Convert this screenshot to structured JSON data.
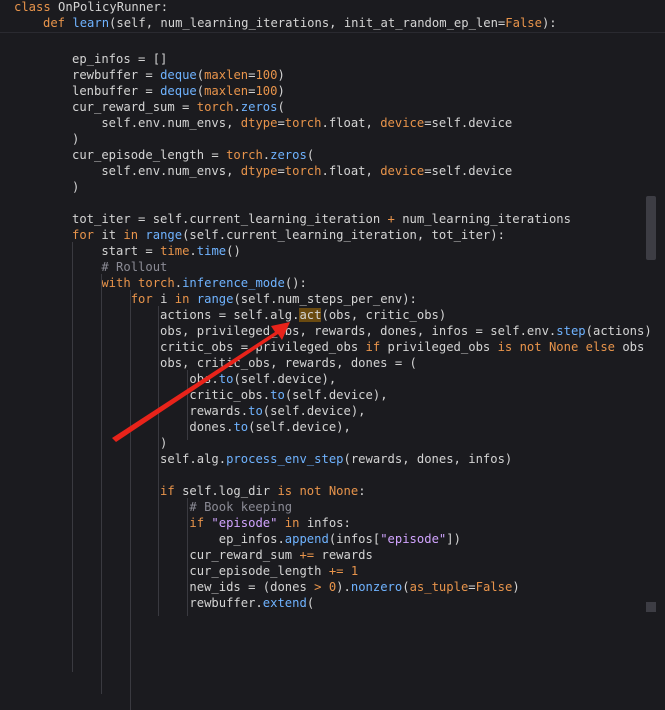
{
  "sticky_lines": [
    [
      [
        "kw",
        "class "
      ],
      [
        "tk",
        "OnPolicyRunner:"
      ]
    ],
    [
      [
        "kw",
        "def "
      ],
      [
        "fn",
        "learn"
      ],
      [
        "tk",
        "(self, num_learning_iterations, init_at_random_ep_len="
      ],
      [
        "kw",
        "False"
      ],
      [
        "tk",
        "):"
      ]
    ]
  ],
  "code_lines": [
    [
      [
        "tk",
        "ep_infos = []"
      ]
    ],
    [
      [
        "tk",
        "rewbuffer = "
      ],
      [
        "fn",
        "deque"
      ],
      [
        "tk",
        "("
      ],
      [
        "kw",
        "maxlen"
      ],
      [
        "tk",
        "="
      ],
      [
        "nm",
        "100"
      ],
      [
        "tk",
        ")"
      ]
    ],
    [
      [
        "tk",
        "lenbuffer = "
      ],
      [
        "fn",
        "deque"
      ],
      [
        "tk",
        "("
      ],
      [
        "kw",
        "maxlen"
      ],
      [
        "tk",
        "="
      ],
      [
        "nm",
        "100"
      ],
      [
        "tk",
        ")"
      ]
    ],
    [
      [
        "tk",
        "cur_reward_sum = "
      ],
      [
        "bi",
        "torch"
      ],
      [
        "tk",
        "."
      ],
      [
        "fn",
        "zeros"
      ],
      [
        "tk",
        "("
      ]
    ],
    [
      [
        "tk",
        "    self.env.num_envs, "
      ],
      [
        "kw",
        "dtype"
      ],
      [
        "tk",
        "="
      ],
      [
        "bi",
        "torch"
      ],
      [
        "tk",
        ".float, "
      ],
      [
        "kw",
        "device"
      ],
      [
        "tk",
        "=self.device"
      ]
    ],
    [
      [
        "tk",
        ")"
      ]
    ],
    [
      [
        "tk",
        "cur_episode_length = "
      ],
      [
        "bi",
        "torch"
      ],
      [
        "tk",
        "."
      ],
      [
        "fn",
        "zeros"
      ],
      [
        "tk",
        "("
      ]
    ],
    [
      [
        "tk",
        "    self.env.num_envs, "
      ],
      [
        "kw",
        "dtype"
      ],
      [
        "tk",
        "="
      ],
      [
        "bi",
        "torch"
      ],
      [
        "tk",
        ".float, "
      ],
      [
        "kw",
        "device"
      ],
      [
        "tk",
        "=self.device"
      ]
    ],
    [
      [
        "tk",
        ")"
      ]
    ],
    [
      [
        "tk",
        ""
      ]
    ],
    [
      [
        "tk",
        "tot_iter = self.current_learning_iteration "
      ],
      [
        "op",
        "+"
      ],
      [
        "tk",
        " num_learning_iterations"
      ]
    ],
    [
      [
        "kw",
        "for "
      ],
      [
        "tk",
        "it "
      ],
      [
        "kw",
        "in "
      ],
      [
        "fn",
        "range"
      ],
      [
        "tk",
        "(self.current_learning_iteration, tot_iter):"
      ]
    ],
    [
      [
        "tk",
        "    start = "
      ],
      [
        "bi",
        "time"
      ],
      [
        "tk",
        "."
      ],
      [
        "fn",
        "time"
      ],
      [
        "tk",
        "()"
      ]
    ],
    [
      [
        "cm",
        "    # Rollout"
      ]
    ],
    [
      [
        "kw",
        "    with "
      ],
      [
        "bi",
        "torch"
      ],
      [
        "tk",
        "."
      ],
      [
        "fn",
        "inference_mode"
      ],
      [
        "tk",
        "():"
      ]
    ],
    [
      [
        "kw",
        "        for "
      ],
      [
        "tk",
        "i "
      ],
      [
        "kw",
        "in "
      ],
      [
        "fn",
        "range"
      ],
      [
        "tk",
        "(self.num_steps_per_env):"
      ]
    ],
    [
      [
        "tk",
        "            actions = self.alg."
      ],
      [
        "hl",
        "act"
      ],
      [
        "tk",
        "(obs, critic_obs)"
      ]
    ],
    [
      [
        "tk",
        "            obs, privileged_obs, rewards, dones, infos = self.env."
      ],
      [
        "fn",
        "step"
      ],
      [
        "tk",
        "(actions)"
      ]
    ],
    [
      [
        "tk",
        "            critic_obs = privileged_obs "
      ],
      [
        "kw",
        "if "
      ],
      [
        "tk",
        "privileged_obs "
      ],
      [
        "kw",
        "is not "
      ],
      [
        "kw",
        "None "
      ],
      [
        "kw",
        "else "
      ],
      [
        "tk",
        "obs"
      ]
    ],
    [
      [
        "tk",
        "            obs, critic_obs, rewards, dones = ("
      ]
    ],
    [
      [
        "tk",
        "                obs."
      ],
      [
        "fn",
        "to"
      ],
      [
        "tk",
        "(self.device),"
      ]
    ],
    [
      [
        "tk",
        "                critic_obs."
      ],
      [
        "fn",
        "to"
      ],
      [
        "tk",
        "(self.device),"
      ]
    ],
    [
      [
        "tk",
        "                rewards."
      ],
      [
        "fn",
        "to"
      ],
      [
        "tk",
        "(self.device),"
      ]
    ],
    [
      [
        "tk",
        "                dones."
      ],
      [
        "fn",
        "to"
      ],
      [
        "tk",
        "(self.device),"
      ]
    ],
    [
      [
        "tk",
        "            )"
      ]
    ],
    [
      [
        "tk",
        "            self.alg."
      ],
      [
        "fn",
        "process_env_step"
      ],
      [
        "tk",
        "(rewards, dones, infos)"
      ]
    ],
    [
      [
        "tk",
        ""
      ]
    ],
    [
      [
        "kw",
        "            if "
      ],
      [
        "tk",
        "self.log_dir "
      ],
      [
        "kw",
        "is not "
      ],
      [
        "kw",
        "None"
      ],
      [
        "tk",
        ":"
      ]
    ],
    [
      [
        "cm",
        "                # Book keeping"
      ]
    ],
    [
      [
        "kw",
        "                if "
      ],
      [
        "st",
        "\"episode\" "
      ],
      [
        "kw",
        "in "
      ],
      [
        "tk",
        "infos:"
      ]
    ],
    [
      [
        "tk",
        "                    ep_infos."
      ],
      [
        "fn",
        "append"
      ],
      [
        "tk",
        "(infos["
      ],
      [
        "st",
        "\"episode\""
      ],
      [
        "tk",
        "])"
      ]
    ],
    [
      [
        "tk",
        "                cur_reward_sum "
      ],
      [
        "op",
        "+="
      ],
      [
        "tk",
        " rewards"
      ]
    ],
    [
      [
        "tk",
        "                cur_episode_length "
      ],
      [
        "op",
        "+="
      ],
      [
        "tk",
        " "
      ],
      [
        "nm",
        "1"
      ]
    ],
    [
      [
        "tk",
        "                new_ids = (dones "
      ],
      [
        "op",
        "> "
      ],
      [
        "nm",
        "0"
      ],
      [
        "tk",
        ")."
      ],
      [
        "fn",
        "nonzero"
      ],
      [
        "tk",
        "("
      ],
      [
        "kw",
        "as_tuple"
      ],
      [
        "tk",
        "="
      ],
      [
        "kw",
        "False"
      ],
      [
        "tk",
        ")"
      ]
    ],
    [
      [
        "tk",
        "                rewbuffer."
      ],
      [
        "fn",
        "extend"
      ],
      [
        "tk",
        "("
      ]
    ]
  ],
  "colors": {
    "background": "#1b1b1f",
    "keyword": "#e8944b",
    "function": "#6fb3ff",
    "text": "#d4d4d4",
    "comment": "#8b8b95",
    "arrow": "#e8231a"
  }
}
